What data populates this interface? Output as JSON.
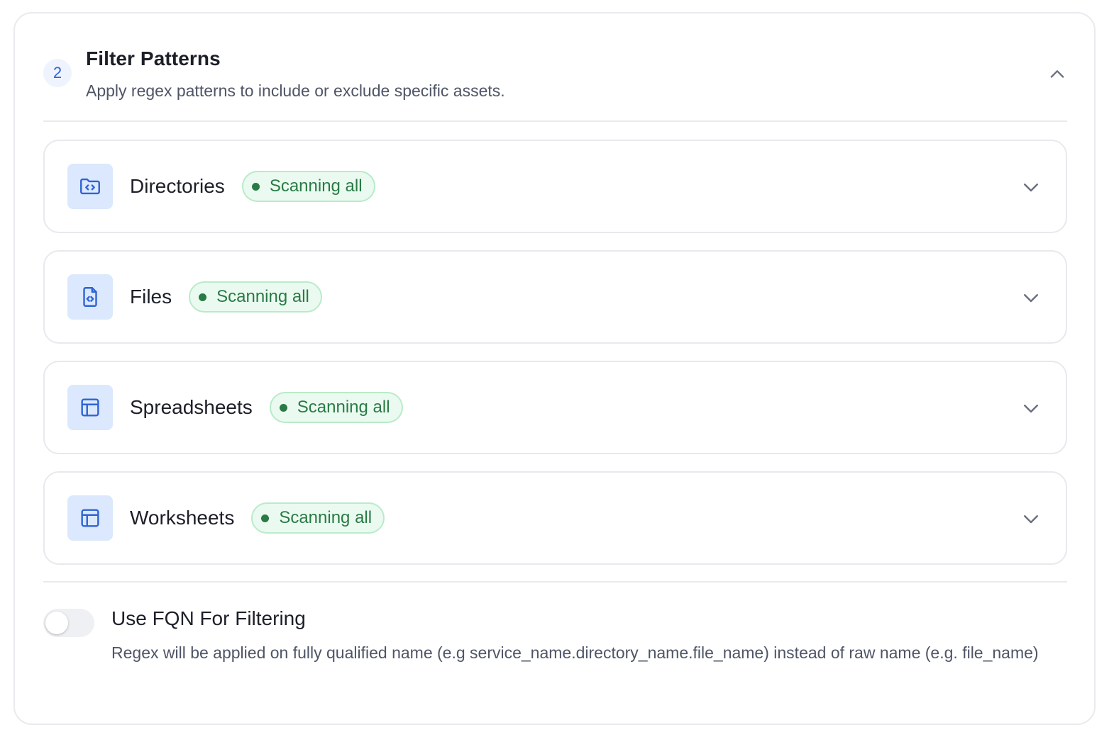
{
  "header": {
    "step_number": "2",
    "title": "Filter Patterns",
    "subtitle": "Apply regex patterns to include or exclude specific assets."
  },
  "sections": [
    {
      "title": "Directories",
      "status": "Scanning all",
      "icon": "folder-code-icon"
    },
    {
      "title": "Files",
      "status": "Scanning all",
      "icon": "file-code-icon"
    },
    {
      "title": "Spreadsheets",
      "status": "Scanning all",
      "icon": "table-icon"
    },
    {
      "title": "Worksheets",
      "status": "Scanning all",
      "icon": "table-icon"
    }
  ],
  "fqn_toggle": {
    "title": "Use FQN For Filtering",
    "description": "Regex will be applied on fully qualified name (e.g service_name.directory_name.file_name) instead of raw name (e.g. file_name)",
    "enabled": false
  },
  "colors": {
    "accent": "#2f63d4",
    "icon_bg": "#dbe8fd",
    "status_text": "#2a7a45",
    "status_bg": "#eafaf0",
    "status_border": "#b9ebc9"
  }
}
